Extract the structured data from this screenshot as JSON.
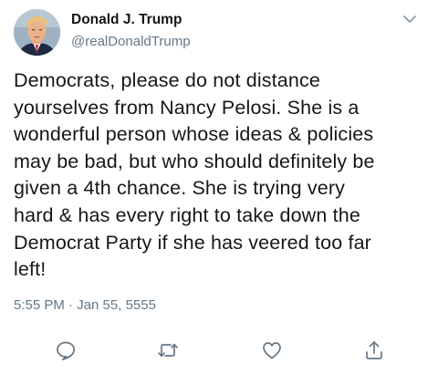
{
  "tweet": {
    "author_name": "Donald J. Trump",
    "author_handle": "@realDonaldTrump",
    "text": "Democrats, please do not distance\nyourselves from Nancy Pelosi. She is a\nwonderful person whose ideas & policies\nmay be bad, but who should definitely be\ngiven a 4th chance. She is trying very\nhard & has every right to take down the\nDemocrat Party if she has veered too far\nleft!",
    "timestamp": "5:55 PM · Jan 55, 5555"
  },
  "icons": {
    "avatar": "avatar",
    "menu": "chevron-down-icon",
    "reply": "reply-icon",
    "retweet": "retweet-icon",
    "like": "heart-icon",
    "share": "share-icon"
  },
  "colors": {
    "text_primary": "#14171a",
    "text_secondary": "#657786",
    "icon": "#657786",
    "background": "#ffffff"
  }
}
